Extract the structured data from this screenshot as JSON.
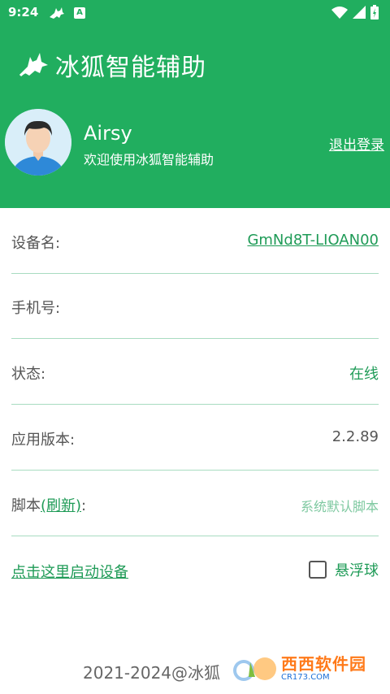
{
  "status_bar": {
    "time": "9:24",
    "notif_letter": "A"
  },
  "app": {
    "title": "冰狐智能辅助"
  },
  "user": {
    "name": "Airsy",
    "welcome": "欢迎使用冰狐智能辅助",
    "logout_label": "退出登录"
  },
  "rows": {
    "device_name": {
      "label": "设备名:",
      "value": "GmNd8T-LIOAN00"
    },
    "phone": {
      "label": "手机号:",
      "value": ""
    },
    "status": {
      "label": "状态:",
      "value": "在线"
    },
    "app_version": {
      "label": "应用版本:",
      "value": "2.2.89"
    },
    "script": {
      "label_prefix": "脚本",
      "refresh_label": "(刷新)",
      "label_suffix": ":",
      "value": "系统默认脚本"
    }
  },
  "actions": {
    "start_device_label": "点击这里启动设备",
    "float_ball_label": "悬浮球",
    "float_ball_checked": false
  },
  "footer": {
    "text": "2021-2024@冰狐"
  },
  "watermark": {
    "main": "西西软件园",
    "sub": "CR173.COM"
  },
  "colors": {
    "header_green": "#21ae5f",
    "accent_green": "#1f9b57",
    "divider": "#a8dcc1"
  }
}
